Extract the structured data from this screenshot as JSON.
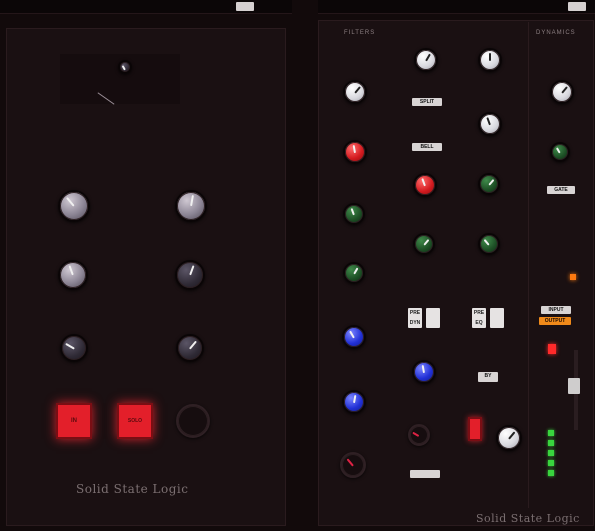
{
  "window": {
    "left_title": "",
    "right_title": ""
  },
  "left_plugin": {
    "brand": "Solid State Logic",
    "buttons": {
      "btn1": "IN",
      "btn2": "SOLO",
      "btn3": ""
    }
  },
  "right_plugin": {
    "brand": "Solid State Logic",
    "sections": {
      "filters": "FILTERS",
      "dynamics": "DYNAMICS"
    },
    "chips": {
      "split": "SPLIT",
      "bell": "BELL",
      "gate": "GATE",
      "input": "INPUT",
      "output": "OUTPUT",
      "bypass": "BY"
    },
    "mini_buttons": [
      {
        "top": "PRE",
        "bottom": "DYN"
      },
      {
        "top": "PRE",
        "bottom": "EQ"
      }
    ]
  },
  "colors": {
    "bg": "#120a0b",
    "panel": "#1a1012",
    "red": "#e31f2a",
    "blue": "#2130d6",
    "green": "#1b4b23",
    "orange": "#f08a1a"
  }
}
